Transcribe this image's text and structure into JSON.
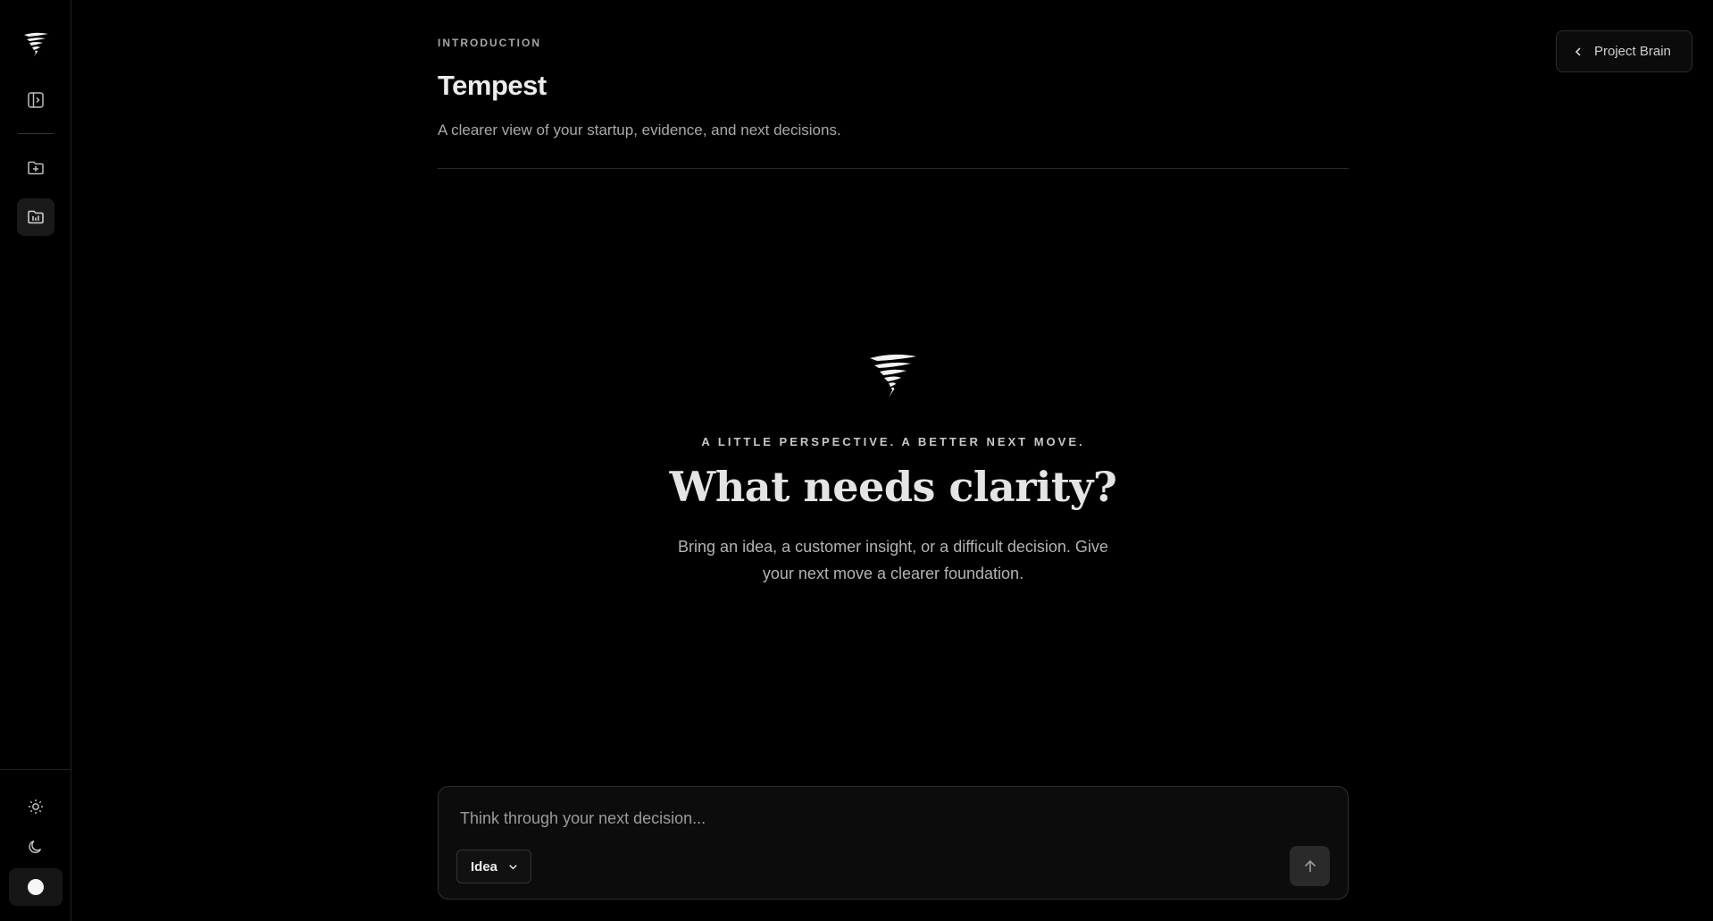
{
  "sidebar": {
    "icons": [
      "tempest-logo-icon",
      "sidebar-toggle-icon",
      "new-folder-icon",
      "projects-folder-icon",
      "sun-icon",
      "moon-icon",
      "circle-icon"
    ]
  },
  "header": {
    "eyebrow": "INTRODUCTION",
    "title": "Tempest",
    "subtitle": "A clearer view of your startup, evidence, and next decisions.",
    "project_brain_label": "Project Brain"
  },
  "hero": {
    "tagline": "A LITTLE PERSPECTIVE. A BETTER NEXT MOVE.",
    "title": "What needs clarity?",
    "description": "Bring an idea, a customer insight, or a difficult decision. Give your next move a clearer foundation."
  },
  "composer": {
    "placeholder": "Think through your next decision...",
    "value": "",
    "mode_selected": "Idea"
  },
  "colors": {
    "background": "#000000",
    "text": "#e8e8e8",
    "muted": "#a9a9a9",
    "border": "#2f2f2f"
  }
}
